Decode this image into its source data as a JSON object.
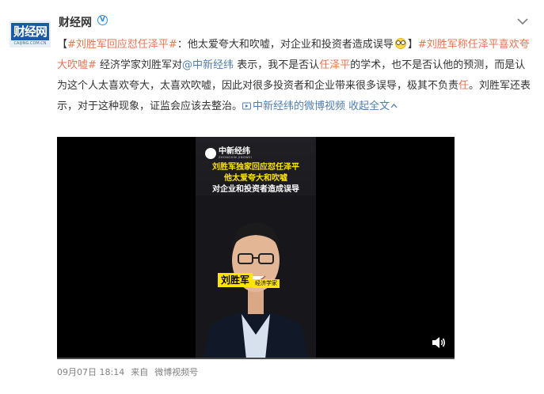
{
  "account": {
    "name": "财经网",
    "avatar_text": "财经网",
    "avatar_sub": "CAIJING.COM.CN"
  },
  "post": {
    "open_bracket": "【",
    "topic1": "#刘胜军回应怼任泽平#",
    "headline": "：他太爱夸大和吹嘘，对企业和投资者造成误导",
    "close_bracket": "】",
    "topic2": "#刘胜军称任泽平喜欢夸大吹嘘#",
    "body1": " 经济学家刘胜军对",
    "mention": "@中新经纬",
    "body2": " 表示，我不是否认",
    "kw1": "任泽平",
    "body3": "的学术，也不是否认他的预测，而是认为这个人太喜欢夸大，太喜欢吹嘘，因此对很多投资者和企业带来很多误导，极其不负责",
    "kw2": "任",
    "body4": "。刘胜军还表示，对于这种现象，证监会应该去整治。",
    "video_link": "中新经纬的微博视频",
    "collapse": "收起全文"
  },
  "video": {
    "logo_text": "中新经纬",
    "logo_sub": "ZHONGXIN JINGWEI",
    "caption_line1": "刘胜军独家回应怼任泽平",
    "caption_line2": "他太爱夸大和吹嘘",
    "caption_line3": "对企业和投资者造成误导",
    "name_tag": "刘胜军",
    "title_tag": "经济学家"
  },
  "meta": {
    "time": "09月07日 18:14",
    "from_label": "来自",
    "source": "微博视频号"
  },
  "colors": {
    "link_orange": "#eb7350",
    "link_blue": "#507daf",
    "verified_blue": "#2b8ee6",
    "caption_yellow": "#ffe400"
  }
}
